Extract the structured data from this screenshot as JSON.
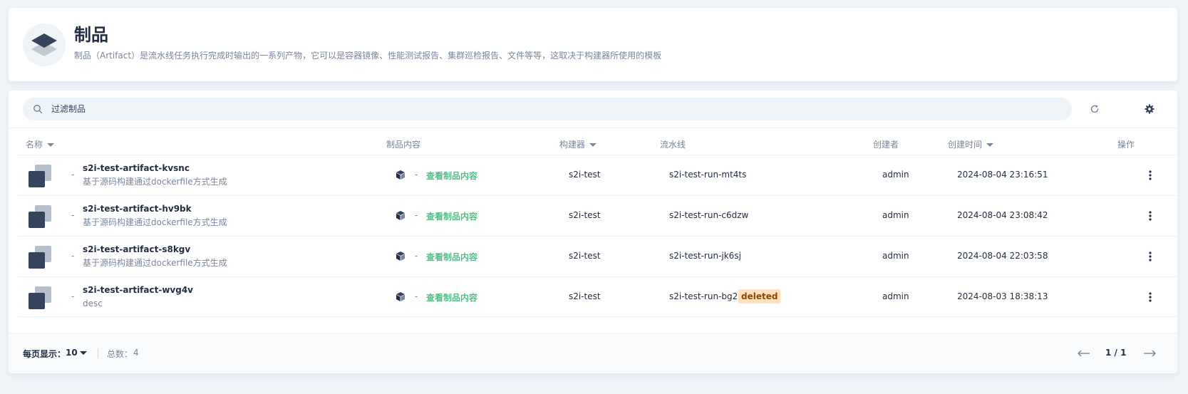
{
  "header": {
    "title": "制品",
    "description": "制品（Artifact）是流水线任务执行完成时输出的一系列产物，它可以是容器镜像、性能测试报告、集群巡检报告、文件等等，这取决于构建器所使用的模板",
    "icon": "artifact-layers-icon"
  },
  "toolbar": {
    "search_placeholder": "过滤制品",
    "search_value": "",
    "refresh_icon": "refresh-icon",
    "settings_icon": "gear-icon"
  },
  "table": {
    "columns": {
      "name": "名称",
      "content": "制品内容",
      "builder": "构建器",
      "pipeline": "流水线",
      "creator": "创建者",
      "created_at": "创建时间",
      "actions": "操作"
    },
    "rows": [
      {
        "name": "s2i-test-artifact-kvsnc",
        "desc": "基于源码构建通过dockerfile方式生成",
        "prefix_dash": "-",
        "content_dash": "-",
        "content_link": "查看制品内容",
        "builder": "s2i-test",
        "pipeline": "s2i-test-run-mt4ts",
        "badge": "",
        "creator": "admin",
        "created_at": "2024-08-04 23:16:51"
      },
      {
        "name": "s2i-test-artifact-hv9bk",
        "desc": "基于源码构建通过dockerfile方式生成",
        "prefix_dash": "-",
        "content_dash": "-",
        "content_link": "查看制品内容",
        "builder": "s2i-test",
        "pipeline": "s2i-test-run-c6dzw",
        "badge": "",
        "creator": "admin",
        "created_at": "2024-08-04 23:08:42"
      },
      {
        "name": "s2i-test-artifact-s8kgv",
        "desc": "基于源码构建通过dockerfile方式生成",
        "prefix_dash": "-",
        "content_dash": "-",
        "content_link": "查看制品内容",
        "builder": "s2i-test",
        "pipeline": "s2i-test-run-jk6sj",
        "badge": "",
        "creator": "admin",
        "created_at": "2024-08-04 22:03:58"
      },
      {
        "name": "s2i-test-artifact-wvg4v",
        "desc": "desc",
        "prefix_dash": "-",
        "content_dash": "-",
        "content_link": "查看制品内容",
        "builder": "s2i-test",
        "pipeline": "s2i-test-run-bg2vj",
        "badge": "deleted",
        "creator": "admin",
        "created_at": "2024-08-03 18:38:13"
      }
    ]
  },
  "footer": {
    "page_size_label": "每页显示：",
    "page_size_value": "10",
    "total_label": "总数：",
    "total_value": "4",
    "page_indicator": "1 / 1"
  },
  "colors": {
    "accent_green": "#55bc8a",
    "badge_bg": "#ffe1be",
    "badge_text": "#8d4704",
    "background": "#eff4f9"
  }
}
